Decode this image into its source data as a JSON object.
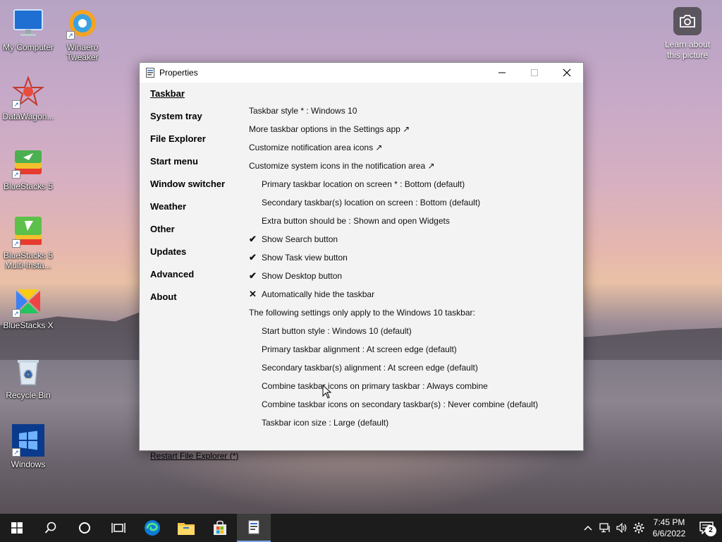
{
  "desktop": {
    "icons": [
      {
        "label": "My Computer"
      },
      {
        "label": "Winaero Tweaker"
      },
      {
        "label": "DataWagon..."
      },
      {
        "label": "BlueStacks 5"
      },
      {
        "label": "BlueStacks 5 Multi-Insta..."
      },
      {
        "label": "BlueStacks X"
      },
      {
        "label": "Recycle Bin"
      },
      {
        "label": "Windows"
      }
    ],
    "learn_label": "Learn about this picture"
  },
  "window": {
    "title": "Properties",
    "nav": [
      {
        "label": "Taskbar",
        "active": true
      },
      {
        "label": "System tray"
      },
      {
        "label": "File Explorer"
      },
      {
        "label": "Start menu"
      },
      {
        "label": "Window switcher"
      },
      {
        "label": "Weather"
      },
      {
        "label": "Other"
      },
      {
        "label": "Updates"
      },
      {
        "label": "Advanced"
      },
      {
        "label": "About"
      }
    ],
    "restart_label": "Restart File Explorer (*)",
    "options": [
      {
        "text": "Taskbar style * : Windows 10"
      },
      {
        "text": "More taskbar options in the Settings app ↗"
      },
      {
        "text": "Customize notification area icons ↗"
      },
      {
        "text": "Customize system icons in the notification area ↗"
      },
      {
        "text": "Primary taskbar location on screen * : Bottom (default)"
      },
      {
        "text": "Secondary taskbar(s) location on screen : Bottom (default)"
      },
      {
        "text": "Extra button should be : Shown and open Widgets"
      },
      {
        "text": "Show Search button",
        "mark": "✔"
      },
      {
        "text": "Show Task view button",
        "mark": "✔"
      },
      {
        "text": "Show Desktop button",
        "mark": "✔"
      },
      {
        "text": "Automatically hide the taskbar",
        "mark": "✕"
      },
      {
        "text": "The following settings only apply to the Windows 10 taskbar:"
      },
      {
        "text": "Start button style : Windows 10 (default)"
      },
      {
        "text": "Primary taskbar alignment : At screen edge (default)"
      },
      {
        "text": "Secondary taskbar(s) alignment : At screen edge (default)"
      },
      {
        "text": "Combine taskbar icons on primary taskbar : Always combine"
      },
      {
        "text": "Combine taskbar icons on secondary taskbar(s) : Never combine (default)"
      },
      {
        "text": "Taskbar icon size : Large (default)"
      }
    ]
  },
  "taskbar": {
    "time": "7:45 PM",
    "date": "6/6/2022",
    "notification_count": "2"
  },
  "colors": {
    "taskbar_bg": "#1c1c1c",
    "window_bg": "#f3f3f3",
    "accent": "#7aa7e6"
  }
}
